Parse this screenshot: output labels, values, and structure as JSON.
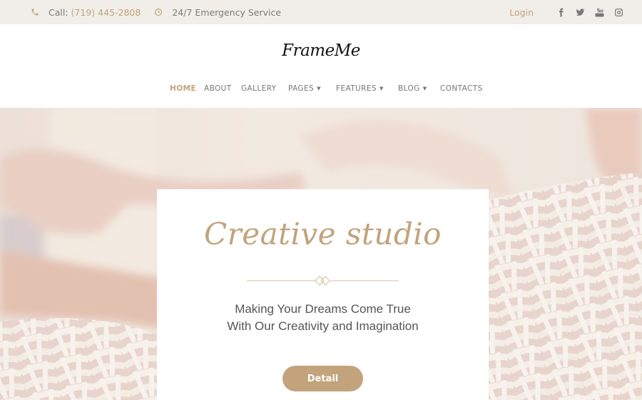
{
  "topbar": {
    "phone_label": "Call:",
    "phone_number": "(719) 445-2808",
    "emergency_text": "24/7 Emergency Service",
    "login_label": "Login",
    "social_icons": [
      "facebook-icon",
      "twitter-icon",
      "youtube-icon",
      "instagram-icon"
    ]
  },
  "header": {
    "logo": "FrameMe",
    "nav": [
      {
        "label": "Home",
        "active": true,
        "dropdown": false
      },
      {
        "label": "About",
        "active": false,
        "dropdown": false
      },
      {
        "label": "Gallery",
        "active": false,
        "dropdown": false
      },
      {
        "label": "Pages",
        "active": false,
        "dropdown": true
      },
      {
        "label": "Features",
        "active": false,
        "dropdown": true
      },
      {
        "label": "Blog",
        "active": false,
        "dropdown": true
      },
      {
        "label": "Contacts",
        "active": false,
        "dropdown": false
      }
    ]
  },
  "hero": {
    "title": "Creative studio",
    "subtitle": "Making Your Dreams Come True With Our Creativity and Imagination",
    "button_label": "Detail"
  },
  "colors": {
    "accent": "#c2a37c",
    "topbar_bg": "#f1eee9",
    "text": "#777777"
  }
}
